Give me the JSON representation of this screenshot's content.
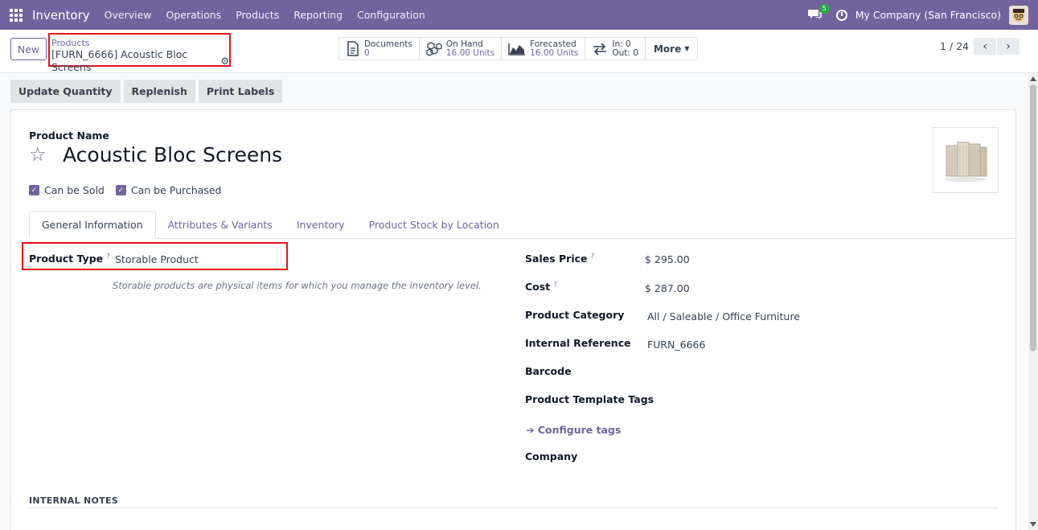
{
  "navbar": {
    "brand": "Inventory",
    "menu": [
      "Overview",
      "Operations",
      "Products",
      "Reporting",
      "Configuration"
    ],
    "chat_badge": "5",
    "company": "My Company (San Francisco)"
  },
  "control": {
    "new_label": "New",
    "breadcrumb_parent": "Products",
    "breadcrumb_current": "[FURN_6666] Acoustic Bloc Screens",
    "stats": {
      "documents_label": "Documents",
      "documents_value": "0",
      "onhand_label": "On Hand",
      "onhand_value": "16.00 Units",
      "forecasted_label": "Forecasted",
      "forecasted_value": "16.00 Units",
      "in_label": "In: 0",
      "out_label": "Out: 0"
    },
    "more_label": "More",
    "pager": "1 / 24"
  },
  "actions": [
    "Update Quantity",
    "Replenish",
    "Print Labels"
  ],
  "form": {
    "product_name_label": "Product Name",
    "product_name": "Acoustic Bloc Screens",
    "can_be_sold": "Can be Sold",
    "can_be_purchased": "Can be Purchased",
    "tabs": [
      "General Information",
      "Attributes & Variants",
      "Inventory",
      "Product Stock by Location"
    ],
    "product_type_label": "Product Type",
    "product_type": "Storable Product",
    "product_type_help": "Storable products are physical items for which you manage the inventory level.",
    "sales_price_label": "Sales Price",
    "sales_price": "$ 295.00",
    "cost_label": "Cost",
    "cost": "$ 287.00",
    "category_label": "Product Category",
    "category": "All / Saleable / Office Furniture",
    "internal_ref_label": "Internal Reference",
    "internal_ref": "FURN_6666",
    "barcode_label": "Barcode",
    "tags_label": "Product Template Tags",
    "configure_tags": "Configure tags",
    "company_label": "Company",
    "internal_notes": "INTERNAL NOTES",
    "help_mark": "?"
  },
  "colors": {
    "accent": "#71639e",
    "highlight": "#e5151b"
  }
}
